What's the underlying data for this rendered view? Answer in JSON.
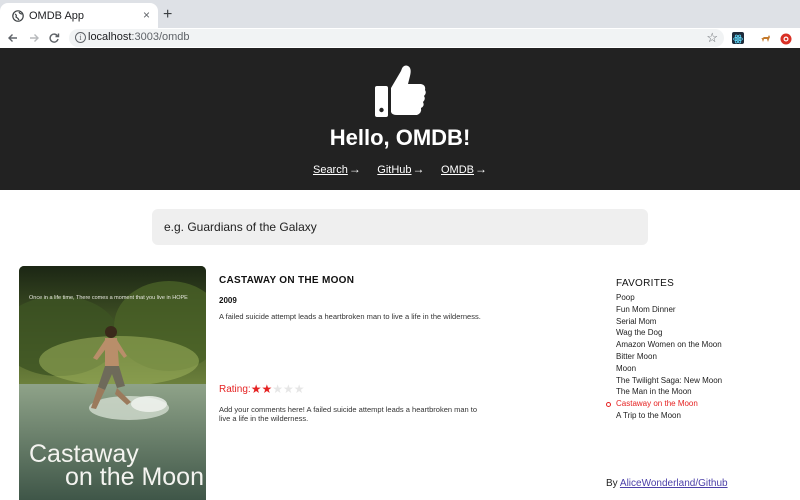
{
  "browser": {
    "tab_title": "OMDB App",
    "tab_close": "×",
    "new_tab": "+",
    "url_host": "localhost",
    "url_path": ":3003/omdb"
  },
  "hero": {
    "title": "Hello, OMDB!",
    "links": [
      {
        "label": "Search",
        "arrow": "→"
      },
      {
        "label": "GitHub",
        "arrow": "→"
      },
      {
        "label": "OMDB",
        "arrow": "→"
      }
    ]
  },
  "search": {
    "placeholder": "e.g. Guardians of the Galaxy",
    "value": ""
  },
  "poster": {
    "tagline": "Once in a life time, There comes a moment that you live in HOPE",
    "title_line1": "Castaway",
    "title_line2": "on the Moon"
  },
  "movie": {
    "title": "CASTAWAY ON THE MOON",
    "year": "2009",
    "plot": "A failed suicide attempt leads a heartbroken man to live a life in the wilderness.",
    "rating_label": "Rating:",
    "rating_value": 2,
    "rating_max": 5,
    "comment": "Add your comments here! A failed suicide attempt leads a heartbroken man to live a life in the wilderness."
  },
  "favorites": {
    "heading": "FAVORITES",
    "items": [
      "Poop",
      "Fun Mom Dinner",
      "Serial Mom",
      "Wag the Dog",
      "Amazon Women on the Moon",
      "Bitter Moon",
      "Moon",
      "The Twilight Saga: New Moon",
      "The Man in the Moon",
      "Castaway on the Moon",
      "A Trip to the Moon"
    ],
    "active_index": 9
  },
  "credit": {
    "prefix": "By",
    "link": "AliceWonderland/Github"
  },
  "colors": {
    "hero_bg": "#222222",
    "accent_red": "#e52222",
    "link_purple": "#4b3fa8",
    "search_bg": "#efefef"
  },
  "icons": {
    "header": "thumbs-up-icon",
    "back": "arrow-left-icon",
    "forward": "arrow-right-icon",
    "reload": "reload-icon",
    "bookmark": "star-icon"
  }
}
